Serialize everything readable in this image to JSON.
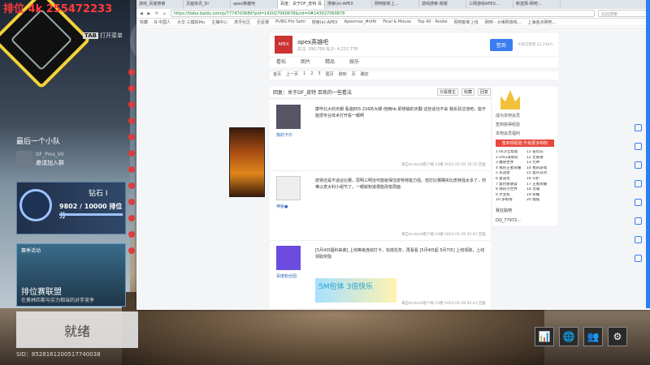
{
  "game": {
    "stream_banner": "排位 4k 255472233",
    "tab_hint_key": "TAB",
    "tab_hint_text": "打开菜单",
    "squad_title": "最后一个小队",
    "squad_player_name": "DF_Pros_VII",
    "squad_invite": "邀请加入群",
    "rank_name": "钻石 I",
    "rank_points": "9802 / 10000 排位分",
    "rank_progress": 0.98,
    "promo_tag": "赛季活动",
    "promo_title": "排位赛联盟",
    "promo_sub": "在奥林匹斯与实力相当的对手竞争",
    "ready_label": "就绪",
    "sid": "SID：8528161200517740038",
    "bottom_icons": [
      "📊",
      "🌐",
      "👥",
      "⚙"
    ]
  },
  "browser": {
    "tabs": [
      "游戏_百度搜索",
      "页面资讯_Dr",
      "apex英雄吧",
      "百度：关于DF_皮特 百...",
      "搜索(e)-APEX",
      "网吧斯新上...",
      "游戏搜索-谢谢",
      "三网游戏APEX...",
      "新选择-网吧..."
    ],
    "active_tab": 3,
    "nav_icons": "◀ ▶ ⟳ ⌂",
    "url": "https://tieba.baidu.com/p/7774703689?pid=143027060878&cid=0#143027060878",
    "search_placeholder": "在此搜索",
    "bookmarks": [
      "收藏",
      "B 中国人",
      "大华 三模拟Mu",
      "主播中心",
      "虎牙社区",
      "巨星赛",
      "PUBG Pro Setti",
      "搜索(e)-APEX",
      "Apexmax_#ofAl",
      "Final & Mouse",
      "Top 40 - Rooke",
      "网吧斯新上线",
      "网吧 - 大维网游戏...",
      "上海金点网吧..."
    ]
  },
  "forum": {
    "logo": "APEX",
    "name": "apex英雄吧",
    "stats": "关注: 390,756  帖子: 4,237,778",
    "sign_button": "签到",
    "sign_info": "今日已签到 21,234人",
    "tabs": [
      "看帖",
      "图片",
      "精品",
      "娱乐"
    ],
    "pager": [
      "首页",
      "上一页",
      "1",
      "2",
      "3",
      "尾页",
      "跳到",
      "页",
      "确定"
    ],
    "thread_title": "回复：关于DF_皮特 百炼的一些看法",
    "thread_actions": [
      "只看楼主",
      "收藏",
      "回复"
    ],
    "posts": [
      {
        "user": "我的卡尔",
        "content": "康毕北大的天朝 看遍855 216的大朝 他俩hb 即使输的天翻 这些话也不会 我反驳过他吧，能不能把专业体术打开看一眼啊",
        "meta": "来自Android客户端  13楼  2022-05-26 16:32  回复"
      },
      {
        "user": "神秘●",
        "content": "皮特还是不适合比赛，思明三明治可能就保住皮特将能力强，但打比赛确实比皮特强太多了，你难以意大利小组节了，一眼就知道很能改变局面",
        "meta": "来自Android客户端  14楼  2022-05-26 20:41  回复"
      },
      {
        "user": "百度粉丝团",
        "content": "[5月4日福利来袭] 上线等级连绩打卡，完成任务，再看看 [5月4日起 5月7日] 上线领取，上线领取奖励",
        "meta": "来自Android客户端  15楼  2022-05-26 20:41  回复",
        "ad_text": "5M包体 3倍快乐"
      }
    ],
    "right": {
      "title": "成为本吧会员",
      "links": [
        "签到获得经验",
        "本吧会员福利"
      ],
      "red_button": "签到领经验 升级更多特权",
      "ranking": [
        "1 kk沙丘帮帮",
        "2 xmu滚筒轮",
        "3 魔兽世界",
        "4 我的王者荣耀",
        "5 长途客",
        "6 夏迪龙",
        "7 复仇者联盟",
        "8 我的小世界",
        "9 大主机",
        "10 多啦啦",
        "11 冒险岛",
        "12 无限进",
        "13 元神",
        "14 我的游戏",
        "15 蛋仔派对",
        "16 守护",
        "17 王者荣耀",
        "18 灵魂",
        "19 荣耀",
        "20 独居"
      ],
      "my_forum": "我在贴吧",
      "my_user": "DQ_77972..."
    }
  }
}
